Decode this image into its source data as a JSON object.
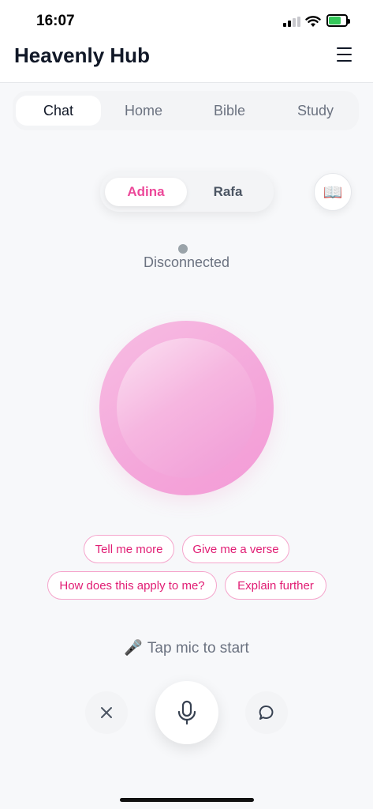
{
  "status_bar": {
    "time": "16:07",
    "icons": [
      "signal-icon",
      "wifi-icon",
      "battery-charging-icon"
    ]
  },
  "header": {
    "title": "Heavenly Hub",
    "menu_icon": "hamburger-menu-icon"
  },
  "tabs": [
    {
      "label": "Chat",
      "active": true
    },
    {
      "label": "Home",
      "active": false
    },
    {
      "label": "Bible",
      "active": false
    },
    {
      "label": "Study",
      "active": false
    }
  ],
  "personas": [
    {
      "label": "Adina",
      "active": true
    },
    {
      "label": "Rafa",
      "active": false
    }
  ],
  "book_button": {
    "icon": "book-icon",
    "glyph": "📖"
  },
  "connection": {
    "status": "Disconnected",
    "dot_color": "#9aa3a9"
  },
  "orb": {
    "accent": "#f4a6da"
  },
  "suggestions": [
    "Tell me more",
    "Give me a verse",
    "How does this apply to me?",
    "Explain further"
  ],
  "hint": {
    "emoji": "🎤",
    "text": "Tap mic to start"
  },
  "controls": {
    "close_icon": "close-icon",
    "mic_icon": "microphone-icon",
    "chat_icon": "chat-bubble-icon"
  },
  "colors": {
    "accent": "#ec4899",
    "chip_border": "#f5a5cc",
    "background": "#f7f8fa"
  }
}
